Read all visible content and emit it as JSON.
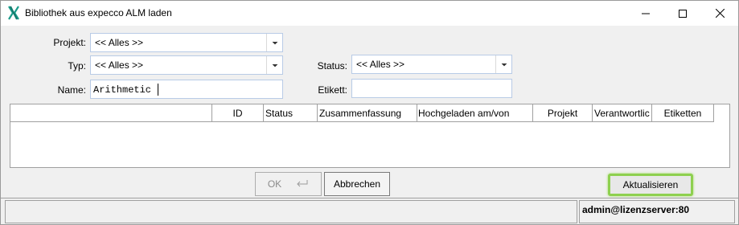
{
  "window": {
    "title": "Bibliothek aus expecco ALM laden",
    "icon": "expecco-x-icon",
    "controls": [
      "minimize-icon",
      "maximize-icon",
      "close-icon"
    ]
  },
  "form": {
    "projekt_label": "Projekt:",
    "projekt_value": "<< Alles >>",
    "typ_label": "Typ:",
    "typ_value": "<< Alles >>",
    "name_label": "Name:",
    "name_value": "Arithmetic",
    "status_label": "Status:",
    "status_value": "<< Alles >>",
    "etikett_label": "Etikett:",
    "etikett_value": ""
  },
  "table": {
    "columns": [
      "",
      "ID",
      "Status",
      "Zusammenfassung",
      "Hochgeladen am/von",
      "Projekt",
      "Verantwortlic",
      "Etiketten"
    ],
    "rows": []
  },
  "buttons": {
    "ok": "OK",
    "cancel": "Abbrechen",
    "refresh": "Aktualisieren"
  },
  "statusbar": {
    "left": "",
    "right": "admin@lizenzserver:80"
  },
  "colors": {
    "accent_highlight": "#8ed04f",
    "field_border": "#b8cbe6",
    "icon_teal": "#1a9c8a"
  }
}
